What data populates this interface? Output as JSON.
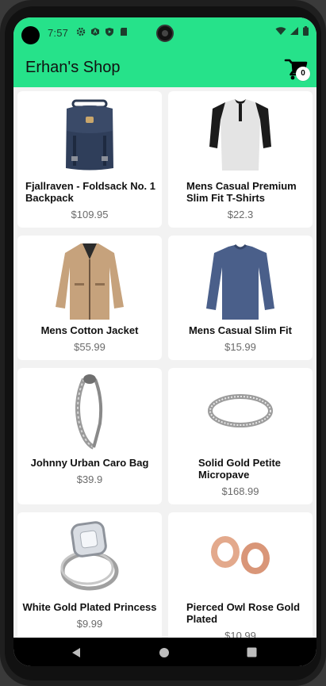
{
  "status": {
    "time": "7:57"
  },
  "appbar": {
    "title": "Erhan's Shop",
    "cart_count": "0"
  },
  "products": [
    {
      "name": "Fjallraven - Foldsack No. 1 Backpack",
      "price": "$109.95"
    },
    {
      "name": "Mens Casual Premium Slim Fit T-Shirts",
      "price": "$22.3"
    },
    {
      "name": "Mens Cotton Jacket",
      "price": "$55.99"
    },
    {
      "name": "Mens Casual Slim Fit",
      "price": "$15.99"
    },
    {
      "name": "Johnny Urban Caro  Bag",
      "price": "$39.9"
    },
    {
      "name": "Solid Gold Petite Micropave",
      "price": "$168.99"
    },
    {
      "name": "White Gold Plated Princess",
      "price": "$9.99"
    },
    {
      "name": "Pierced Owl Rose Gold Plated",
      "price": "$10.99"
    }
  ],
  "icons": {
    "cart": "shopping-cart-icon",
    "back": "back-triangle-icon",
    "home": "home-circle-icon",
    "recents": "recents-square-icon"
  },
  "colors": {
    "accent": "#26e28a",
    "price": "#6b6b6b"
  }
}
